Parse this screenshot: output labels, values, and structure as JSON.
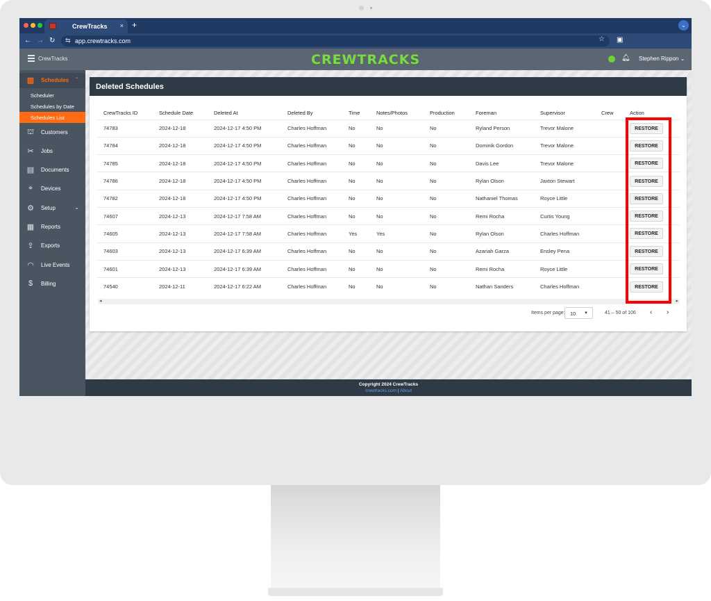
{
  "browser": {
    "tab_title": "CrewTracks",
    "tab_close": "×",
    "new_tab": "+",
    "url": "app.crewtracks.com"
  },
  "header": {
    "brand": "CrewTracks",
    "logo": "CREWTRACKS",
    "user": "Stephen Rippon ⌄"
  },
  "sidebar": {
    "items": [
      {
        "label": "Schedules",
        "icon": "▥"
      },
      {
        "label": "Customers",
        "icon": "⛫"
      },
      {
        "label": "Jobs",
        "icon": "✂"
      },
      {
        "label": "Documents",
        "icon": "▤"
      },
      {
        "label": "Devices",
        "icon": "⌖"
      },
      {
        "label": "Setup",
        "icon": "⚙"
      },
      {
        "label": "Reports",
        "icon": "▦"
      },
      {
        "label": "Exports",
        "icon": "⇪"
      },
      {
        "label": "Live Events",
        "icon": "◠"
      },
      {
        "label": "Billing",
        "icon": "$"
      }
    ],
    "sub_items": [
      {
        "label": "Scheduler"
      },
      {
        "label": "Schedules by Date"
      },
      {
        "label": "Schedules List"
      }
    ]
  },
  "card": {
    "title": "Deleted Schedules"
  },
  "table": {
    "columns": [
      "CrewTracks ID",
      "Schedule Date",
      "Deleted At",
      "Deleted By",
      "Time",
      "Notes/Photos",
      "Production",
      "Foreman",
      "Supervisor",
      "Crew",
      "Action"
    ],
    "action_label": "RESTORE",
    "rows": [
      [
        "74783",
        "2024-12-18",
        "2024-12-17 4:50 PM",
        "Charles Hoffman",
        "No",
        "No",
        "No",
        "Ryland Person",
        "Trevor Malone",
        ""
      ],
      [
        "74784",
        "2024-12-18",
        "2024-12-17 4:50 PM",
        "Charles Hoffman",
        "No",
        "No",
        "No",
        "Dominik Gordon",
        "Trevor Malone",
        ""
      ],
      [
        "74785",
        "2024-12-18",
        "2024-12-17 4:50 PM",
        "Charles Hoffman",
        "No",
        "No",
        "No",
        "Davis Lee",
        "Trevor Malone",
        ""
      ],
      [
        "74786",
        "2024-12-18",
        "2024-12-17 4:50 PM",
        "Charles Hoffman",
        "No",
        "No",
        "No",
        "Rylan Olson",
        "Jaxton Stewart",
        ""
      ],
      [
        "74782",
        "2024-12-18",
        "2024-12-17 4:50 PM",
        "Charles Hoffman",
        "No",
        "No",
        "No",
        "Nathaniel Thomas",
        "Royce Little",
        ""
      ],
      [
        "74607",
        "2024-12-13",
        "2024-12-17 7:58 AM",
        "Charles Hoffman",
        "No",
        "No",
        "No",
        "Remi Rocha",
        "Curtis Young",
        ""
      ],
      [
        "74605",
        "2024-12-13",
        "2024-12-17 7:58 AM",
        "Charles Hoffman",
        "Yes",
        "Yes",
        "No",
        "Rylan Olson",
        "Charles Hoffman",
        ""
      ],
      [
        "74603",
        "2024-12-13",
        "2024-12-17 6:39 AM",
        "Charles Hoffman",
        "No",
        "No",
        "No",
        "Azariah Garza",
        "Ensley Pena",
        ""
      ],
      [
        "74601",
        "2024-12-13",
        "2024-12-17 6:39 AM",
        "Charles Hoffman",
        "No",
        "No",
        "No",
        "Remi Rocha",
        "Royce Little",
        ""
      ],
      [
        "74540",
        "2024-12-11",
        "2024-12-17 6:22 AM",
        "Charles Hoffman",
        "No",
        "No",
        "No",
        "Nathan Sanders",
        "Charles Hoffman",
        ""
      ]
    ]
  },
  "pagination": {
    "items_per_page_label": "Items per page:",
    "items_per_page": "10",
    "range": "41 – 50 of 106",
    "prev": "‹",
    "next": "›"
  },
  "footer": {
    "copyright": "Copyright 2024 CrewTracks",
    "link1": "crewtracks.com",
    "separator": "|",
    "link2": "About"
  },
  "colors": {
    "accent": "#ff6a13",
    "logo_green": "#7bd94a",
    "highlight": "#ff0000"
  }
}
